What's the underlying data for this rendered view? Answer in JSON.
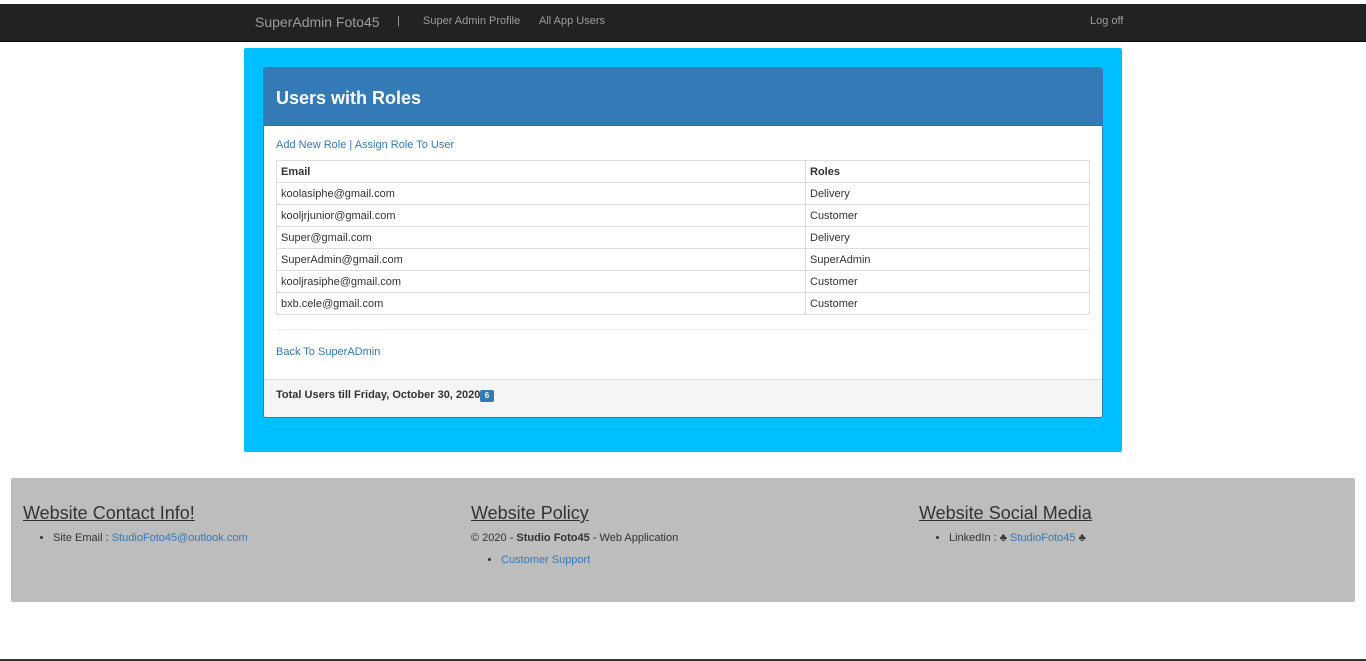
{
  "navbar": {
    "brand": "SuperAdmin Foto45",
    "separator": "|",
    "links": [
      "Super Admin Profile",
      "All App Users"
    ],
    "logoff": "Log off"
  },
  "panel": {
    "title": "Users with Roles",
    "add_role_link": "Add New Role",
    "link_separator": "|",
    "assign_role_link": "Assign Role To User",
    "table": {
      "headers": [
        "Email",
        "Roles"
      ],
      "rows": [
        [
          "koolasiphe@gmail.com",
          "Delivery"
        ],
        [
          "kooljrjunior@gmail.com",
          "Customer"
        ],
        [
          "Super@gmail.com",
          "Delivery"
        ],
        [
          "SuperAdmin@gmail.com",
          "SuperAdmin"
        ],
        [
          "kooljrasiphe@gmail.com",
          "Customer"
        ],
        [
          "bxb.cele@gmail.com",
          "Customer"
        ]
      ]
    },
    "back_link": "Back To SuperADmin",
    "total_label": "Total Users till Friday, October 30, 2020 :",
    "total_count": "6"
  },
  "footer": {
    "contact": {
      "heading": "Website Contact Info!",
      "email_label": "Site Email :",
      "email": "StudioFoto45@outlook.com"
    },
    "policy": {
      "heading": "Website Policy",
      "copyright_prefix": "© 2020 -",
      "company": "Studio Foto45",
      "suffix": "- Web Application",
      "support_link": "Customer Support"
    },
    "social": {
      "heading": "Website Social Media",
      "linkedin_label": "LinkedIn : ♣",
      "linkedin_link": "StudioFoto45",
      "linkedin_suffix": "♣"
    }
  },
  "colors": {
    "navbar": "#222222",
    "outer_container": "#00bfff",
    "panel_heading": "#337ab7",
    "footer": "#bdbdbd",
    "link": "#337ab7"
  }
}
